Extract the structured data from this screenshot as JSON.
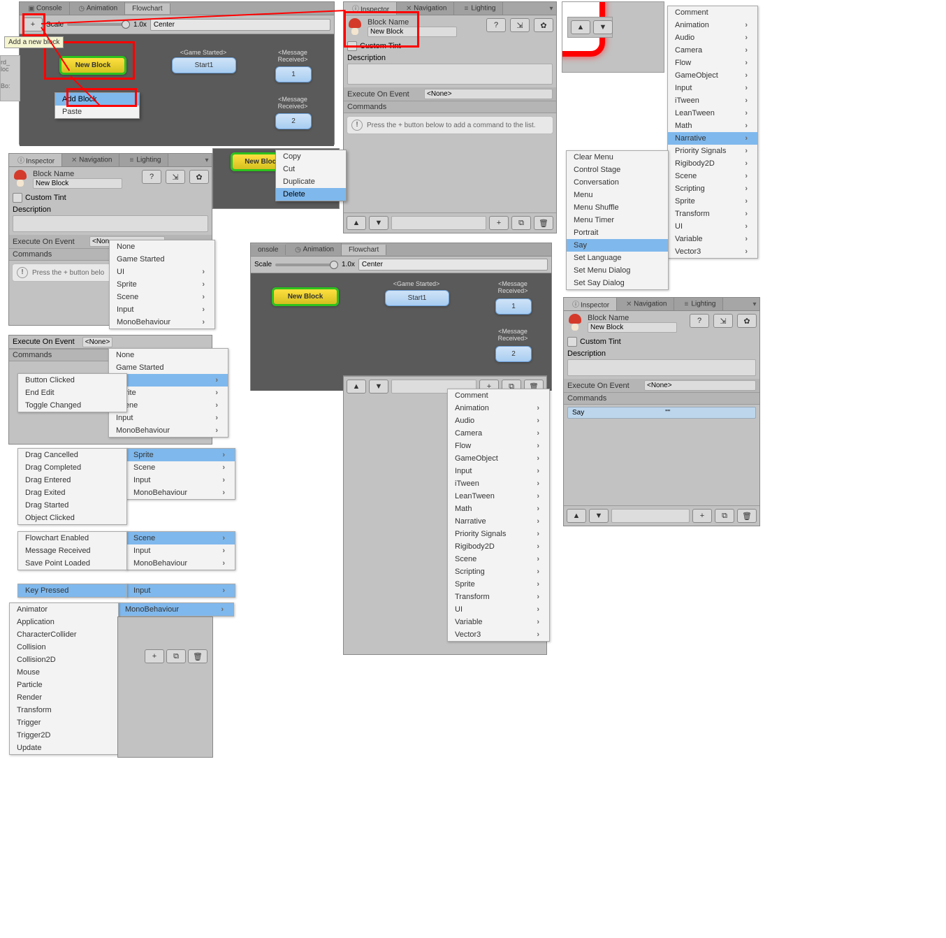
{
  "tabs": {
    "console": "Console",
    "animation": "Animation",
    "flowchart": "Flowchart",
    "onsole": "onsole"
  },
  "toolbar": {
    "scale": "Scale",
    "zoom": "1.0x",
    "center": "Center",
    "plus": "+"
  },
  "tooltip_add": "Add a new block",
  "blocks": {
    "new": "New Block",
    "start1": "Start1",
    "one": "1",
    "two": "2",
    "title_game_started": "<Game Started>",
    "title_msg_recv": "<Message Received>"
  },
  "ctx_block": {
    "add": "Add Block",
    "paste": "Paste"
  },
  "ctx_block2": {
    "copy": "Copy",
    "cut": "Cut",
    "dup": "Duplicate",
    "del": "Delete"
  },
  "inspector": {
    "tab_inspector": "Inspector",
    "tab_navigation": "Navigation",
    "tab_lighting": "Lighting",
    "block_name_label": "Block Name",
    "block_name_value": "New Block",
    "custom_tint": "Custom Tint",
    "description": "Description",
    "execute_on_event": "Execute On Event",
    "none_opt": "<None>",
    "commands": "Commands",
    "press_plus": "Press the + button below to add a command to the list.",
    "say_cmd": "Say",
    "say_val": "\"\""
  },
  "sidebar_hint": {
    "rd": "rd_",
    "loc": "loc",
    "bo": "Bo:"
  },
  "evmenu1": {
    "none": "None",
    "game_started": "Game Started",
    "ui": "UI",
    "sprite": "Sprite",
    "scene": "Scene",
    "input": "Input",
    "mono": "MonoBehaviour"
  },
  "evmenu_ui": {
    "button_clicked": "Button Clicked",
    "end_edit": "End Edit",
    "toggle_changed": "Toggle Changed"
  },
  "evmenu_sprite": {
    "drag_cancelled": "Drag Cancelled",
    "drag_completed": "Drag Completed",
    "drag_entered": "Drag Entered",
    "drag_exited": "Drag Exited",
    "drag_started": "Drag Started",
    "object_clicked": "Object Clicked"
  },
  "evmenu_scene": {
    "flowchart_enabled": "Flowchart Enabled",
    "message_received": "Message Received",
    "save_point_loaded": "Save Point Loaded"
  },
  "evmenu_input": {
    "key_pressed": "Key Pressed"
  },
  "evmenu_mono": {
    "animator": "Animator",
    "application": "Application",
    "character_collider": "CharacterCollider",
    "collision": "Collision",
    "collision2d": "Collision2D",
    "mouse": "Mouse",
    "particle": "Particle",
    "render": "Render",
    "transform": "Transform",
    "trigger": "Trigger",
    "trigger2d": "Trigger2D",
    "update": "Update"
  },
  "cmdcat": {
    "comment": "Comment",
    "animation": "Animation",
    "audio": "Audio",
    "camera": "Camera",
    "flow": "Flow",
    "gameobject": "GameObject",
    "input": "Input",
    "itween": "iTween",
    "leantween": "LeanTween",
    "math": "Math",
    "narrative": "Narrative",
    "priority": "Priority Signals",
    "rigidbody": "Rigibody2D",
    "scene": "Scene",
    "scripting": "Scripting",
    "sprite": "Sprite",
    "transform": "Transform",
    "ui": "UI",
    "variable": "Variable",
    "vector3": "Vector3"
  },
  "narrative_sub": {
    "clear_menu": "Clear Menu",
    "control_stage": "Control Stage",
    "conversation": "Conversation",
    "menu": "Menu",
    "menu_shuffle": "Menu Shuffle",
    "menu_timer": "Menu Timer",
    "portrait": "Portrait",
    "say": "Say",
    "set_language": "Set Language",
    "set_menu_dialog": "Set Menu Dialog",
    "set_say_dialog": "Set Say Dialog"
  },
  "icons": {
    "up": "▲",
    "down": "▼",
    "copy": "⧉",
    "trash": "🗑",
    "plus": "+"
  }
}
